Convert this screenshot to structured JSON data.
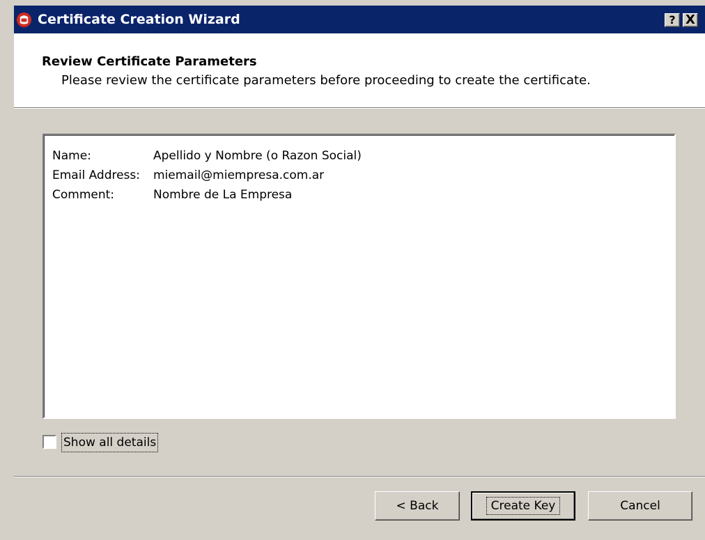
{
  "window": {
    "title": "Certificate Creation Wizard",
    "help_glyph": "?",
    "close_glyph": "X",
    "icon": "certificate-wizard-icon"
  },
  "header": {
    "title": "Review Certificate Parameters",
    "subtitle": "Please review the certificate parameters before proceeding to create the certificate."
  },
  "parameters": [
    {
      "label": "Name:",
      "value": "Apellido y Nombre (o Razon Social)"
    },
    {
      "label": "Email Address:",
      "value": "miemail@miempresa.com.ar"
    },
    {
      "label": "Comment:",
      "value": "Nombre de La Empresa"
    }
  ],
  "options": {
    "show_all_details_label": "Show all details",
    "show_all_details_checked": false
  },
  "buttons": {
    "back": "< Back",
    "create_key": "Create Key",
    "cancel": "Cancel"
  },
  "colors": {
    "titlebar": "#0a246a",
    "face": "#d4d0c8",
    "icon_red": "#d22a1e"
  }
}
